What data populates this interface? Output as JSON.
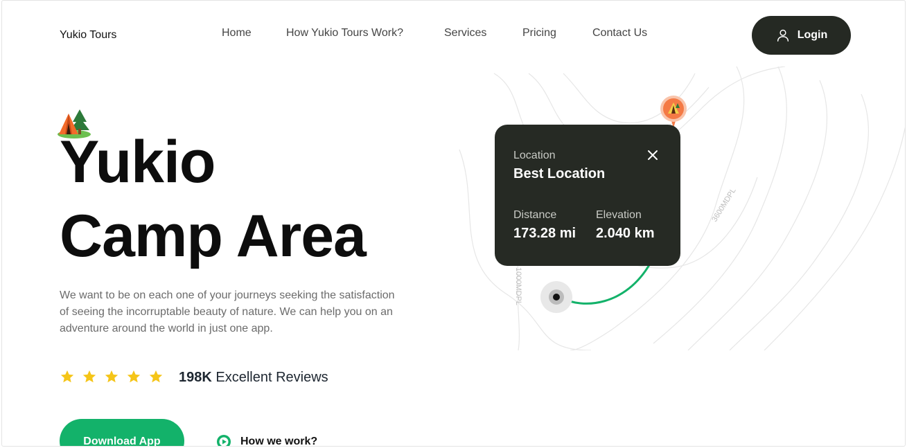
{
  "header": {
    "brand": "Yukio Tours",
    "nav": [
      {
        "label": "Home"
      },
      {
        "label": "How Yukio Tours Work?"
      },
      {
        "label": "Services"
      },
      {
        "label": "Pricing"
      },
      {
        "label": "Contact Us"
      }
    ],
    "login_label": "Login"
  },
  "hero": {
    "title_line1": "Yukio",
    "title_line2": "Camp Area",
    "description": "We want to be on each one of your journeys seeking the satisfaction of seeing the incorruptable beauty of nature. We can help you on an adventure around the world in just one app.",
    "rating_stars": 5,
    "review_count": "198K",
    "review_text": "Excellent Reviews",
    "download_label": "Download App",
    "how_label": "How we work?"
  },
  "map": {
    "contour_label_1": "3600MDPL",
    "contour_label_2": "1000MDPL",
    "card": {
      "location_label": "Location",
      "location_value": "Best Location",
      "distance_label": "Distance",
      "distance_value": "173.28 mi",
      "elevation_label": "Elevation",
      "elevation_value": "2.040 km"
    }
  },
  "colors": {
    "accent_green": "#13b26a",
    "dark": "#252923",
    "star": "#f5c518",
    "pin": "#f47a45"
  }
}
